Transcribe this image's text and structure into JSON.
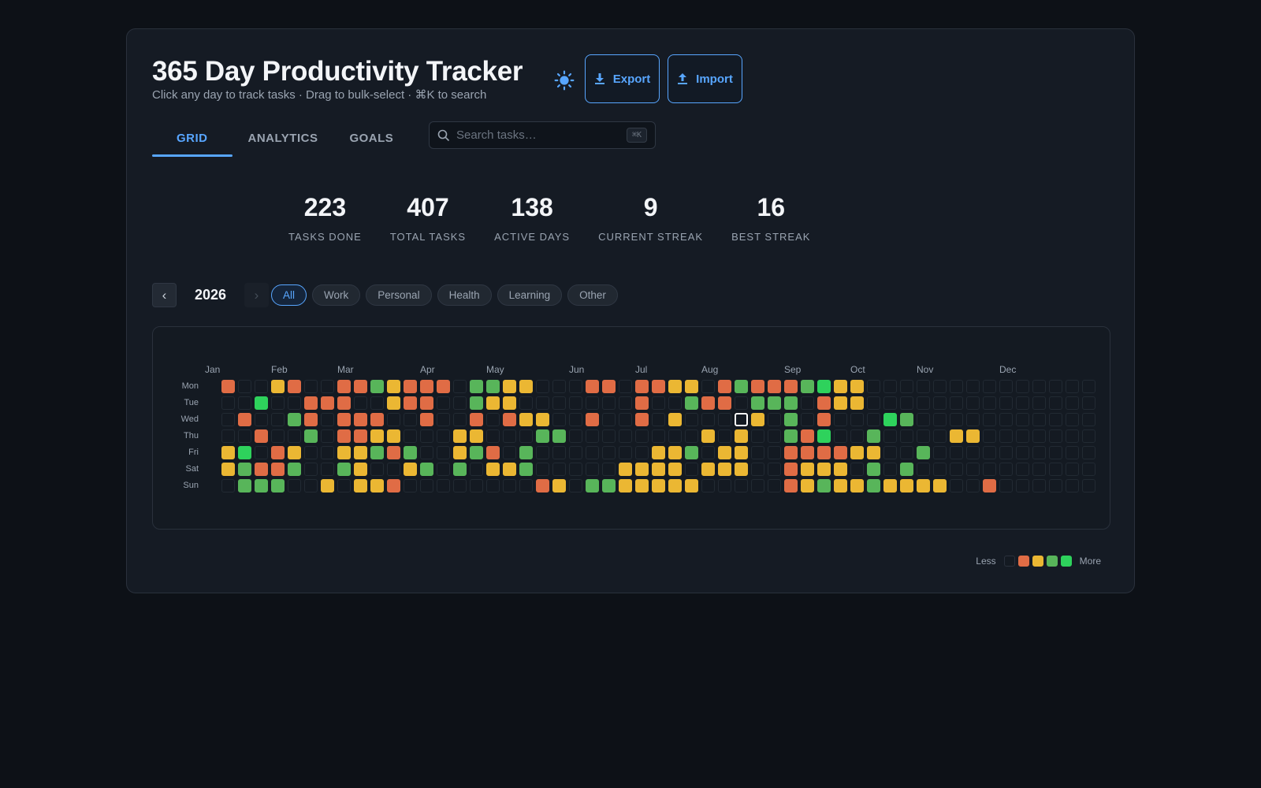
{
  "header": {
    "title": "365 Day Productivity Tracker",
    "subtitle": "Click any day to track tasks · Drag to bulk-select · ⌘K to search",
    "export_label": "Export",
    "import_label": "Import"
  },
  "tabs": [
    {
      "label": "GRID",
      "active": true
    },
    {
      "label": "ANALYTICS",
      "active": false
    },
    {
      "label": "GOALS",
      "active": false
    }
  ],
  "search": {
    "placeholder": "Search tasks…",
    "shortcut": "⌘K"
  },
  "stats": [
    {
      "value": "223",
      "label": "TASKS DONE"
    },
    {
      "value": "407",
      "label": "TOTAL TASKS"
    },
    {
      "value": "138",
      "label": "ACTIVE DAYS"
    },
    {
      "value": "9",
      "label": "CURRENT STREAK"
    },
    {
      "value": "16",
      "label": "BEST STREAK"
    }
  ],
  "year_nav": {
    "prev": "‹",
    "year": "2026",
    "next": "›"
  },
  "filters": [
    {
      "label": "All",
      "active": true
    },
    {
      "label": "Work",
      "active": false
    },
    {
      "label": "Personal",
      "active": false
    },
    {
      "label": "Health",
      "active": false
    },
    {
      "label": "Learning",
      "active": false
    },
    {
      "label": "Other",
      "active": false
    }
  ],
  "grid": {
    "months": [
      {
        "label": "Jan",
        "week": 0
      },
      {
        "label": "Feb",
        "week": 4
      },
      {
        "label": "Mar",
        "week": 8
      },
      {
        "label": "Apr",
        "week": 13
      },
      {
        "label": "May",
        "week": 17
      },
      {
        "label": "Jun",
        "week": 22
      },
      {
        "label": "Jul",
        "week": 26
      },
      {
        "label": "Aug",
        "week": 30
      },
      {
        "label": "Sep",
        "week": 35
      },
      {
        "label": "Oct",
        "week": 39
      },
      {
        "label": "Nov",
        "week": 43
      },
      {
        "label": "Dec",
        "week": 48
      }
    ],
    "days": [
      "Mon",
      "Tue",
      "Wed",
      "Thu",
      "Fri",
      "Sat",
      "Sun"
    ],
    "rows": [
      "x10021001132111033220001101122013111342200000000000000",
      "x00400111002110032200000001003110333012200000000000000",
      "x01003101110010010122001001020000203010004300000000000",
      "x00100301122000220003300000000202003140030000220000000",
      "x24012002231300231030000000223022001111220030000000000",
      "x23113003200230302230000022220222001222030300000000000",
      "x03330020221000000001203322222000001232232222001000000"
    ],
    "today": {
      "row": 2,
      "week": 32
    }
  },
  "legend": {
    "less": "Less",
    "more": "More"
  },
  "colors": {
    "accent": "#58a6ff",
    "level_0": "#141a22",
    "level_1": "#e06c45",
    "level_2": "#ebb733",
    "level_3": "#58b55a",
    "level_4": "#2ed25c"
  }
}
